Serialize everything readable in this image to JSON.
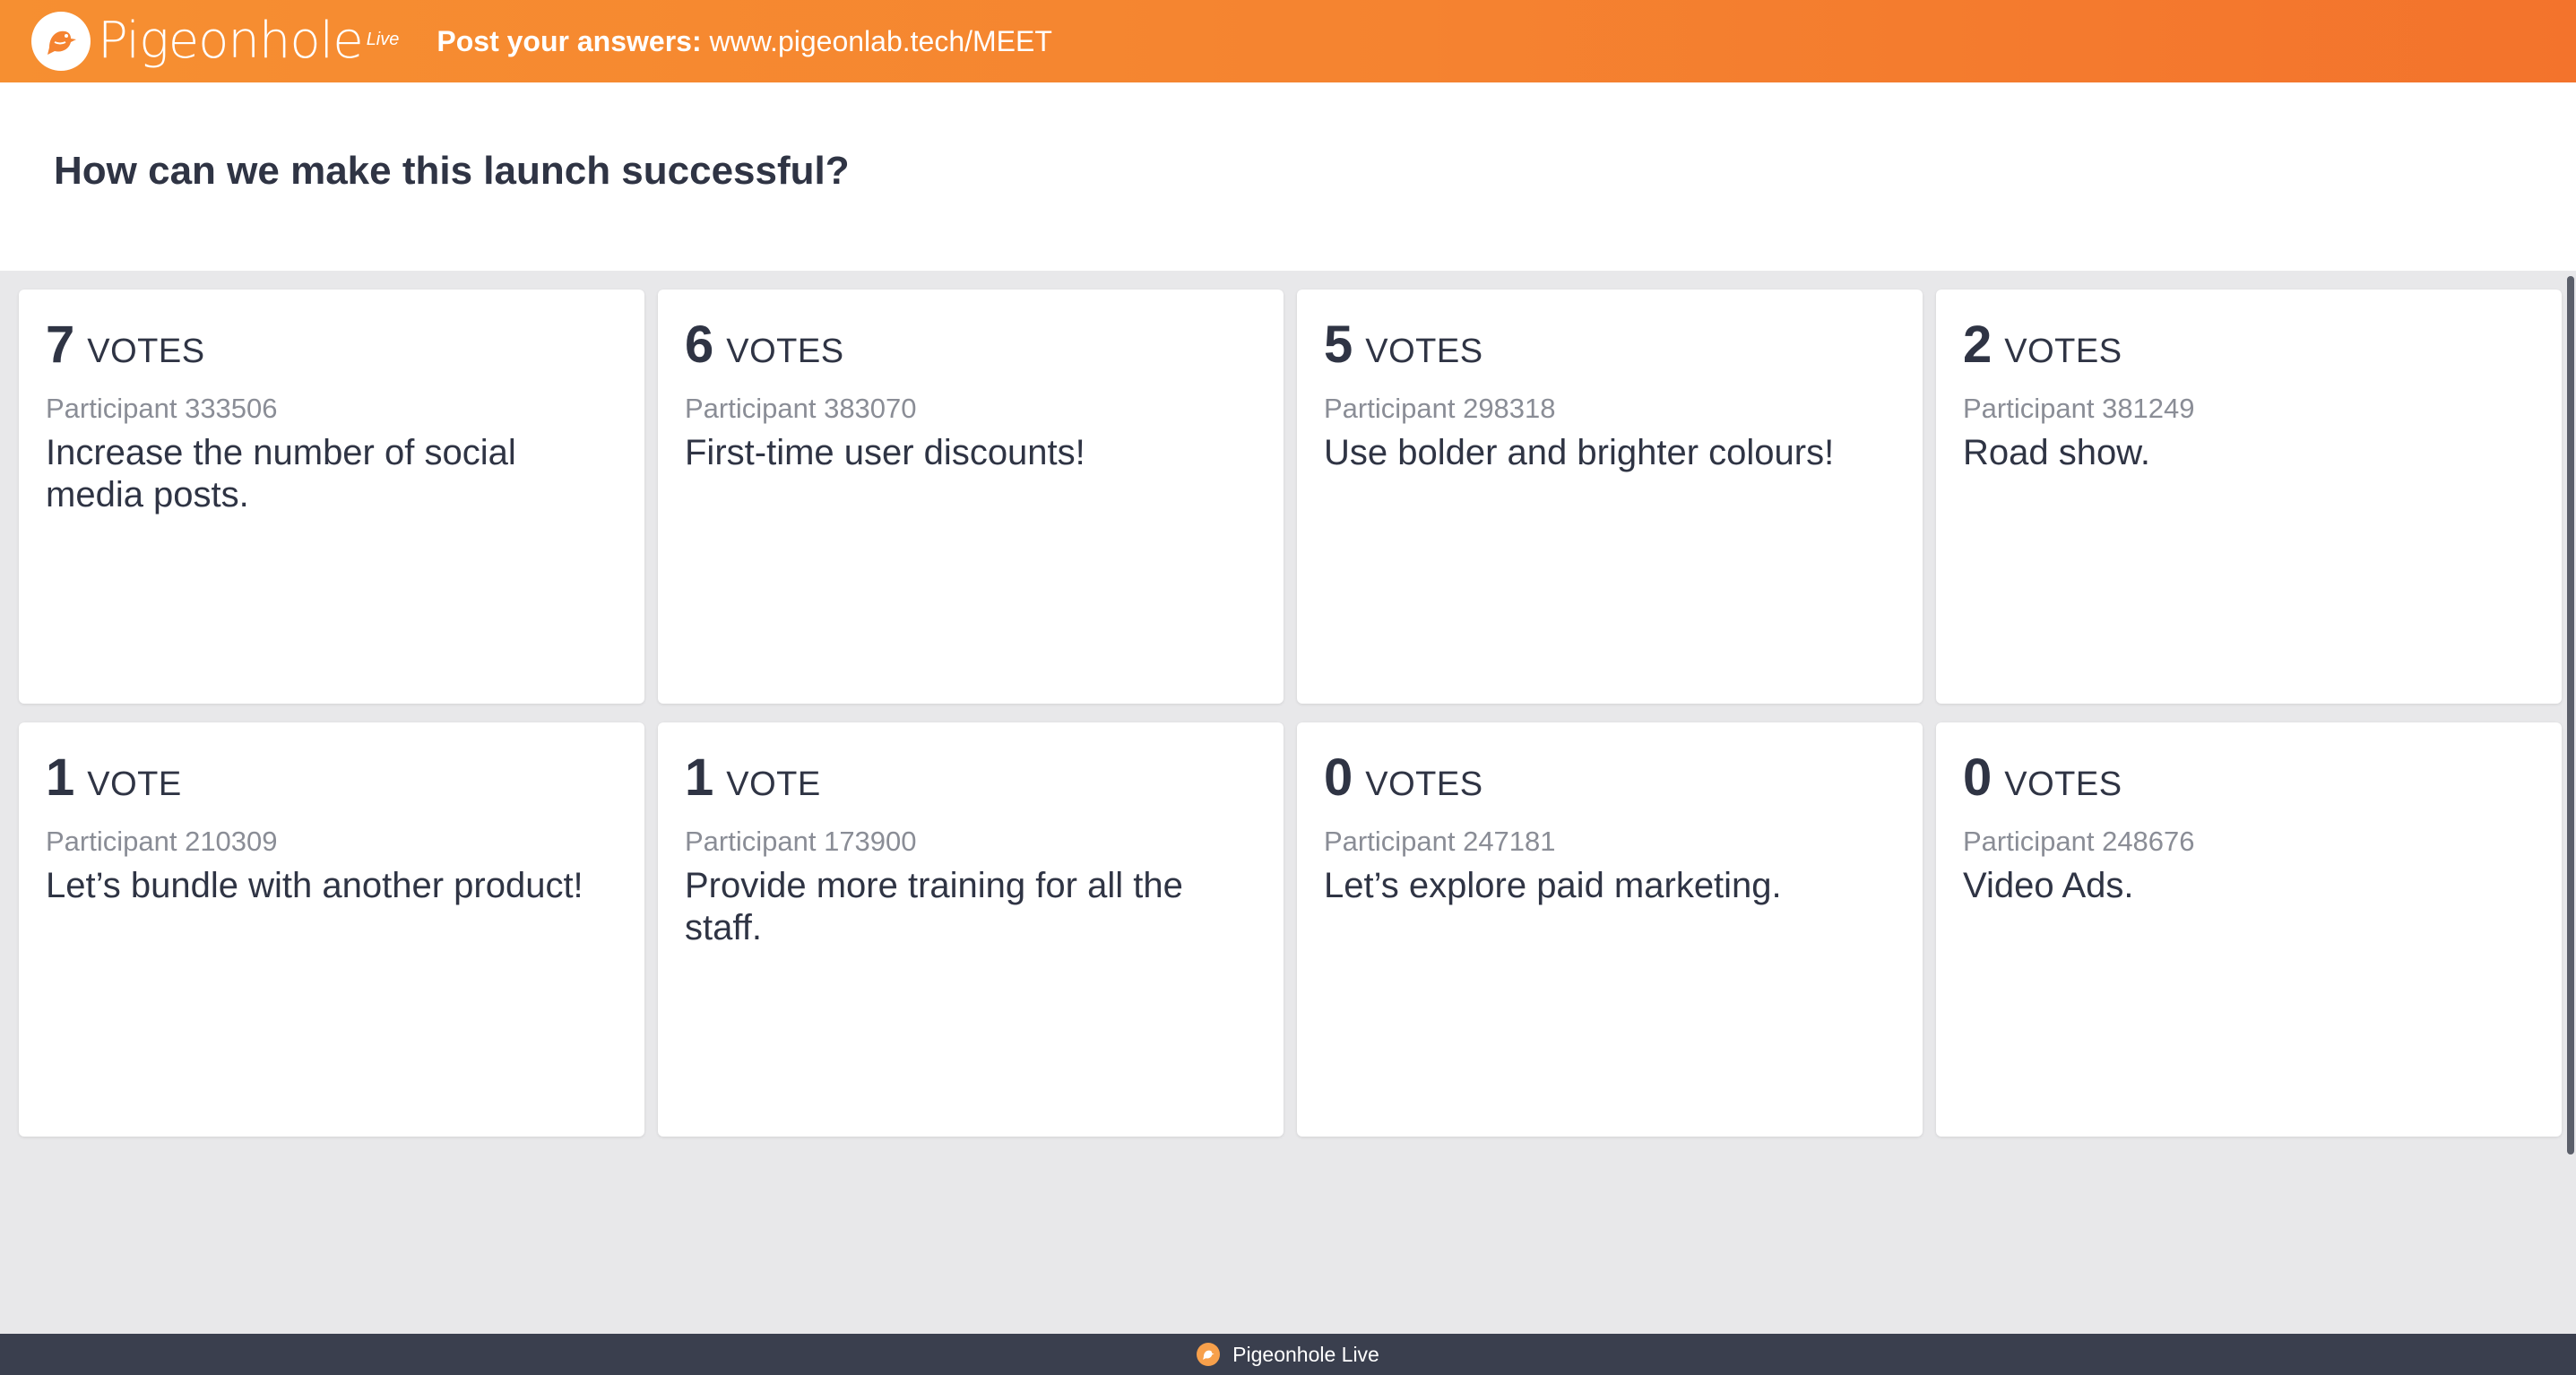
{
  "header": {
    "brand": "Pigeonhole",
    "brand_sup": "Live",
    "post_label": "Post your answers:",
    "post_url": "www.pigeonlab.tech/MEET"
  },
  "question": {
    "title": "How can we make this launch successful?"
  },
  "cards": [
    {
      "votes": "7",
      "unit": "VOTES",
      "participant": "Participant 333506",
      "answer": "Increase the number of social media posts."
    },
    {
      "votes": "6",
      "unit": "VOTES",
      "participant": "Participant 383070",
      "answer": "First-time user discounts!"
    },
    {
      "votes": "5",
      "unit": "VOTES",
      "participant": "Participant 298318",
      "answer": "Use bolder and brighter colours!"
    },
    {
      "votes": "2",
      "unit": "VOTES",
      "participant": "Participant 381249",
      "answer": "Road show."
    },
    {
      "votes": "1",
      "unit": "VOTE",
      "participant": "Participant 210309",
      "answer": "Let’s bundle with another product!"
    },
    {
      "votes": "1",
      "unit": "VOTE",
      "participant": "Participant 173900",
      "answer": "Provide more training for all the staff."
    },
    {
      "votes": "0",
      "unit": "VOTES",
      "participant": "Participant 247181",
      "answer": "Let’s explore paid marketing."
    },
    {
      "votes": "0",
      "unit": "VOTES",
      "participant": "Participant 248676",
      "answer": "Video Ads."
    }
  ],
  "footer": {
    "text": "Pigeonhole Live"
  },
  "colors": {
    "header_orange": "#f58330",
    "text_dark": "#2f3444",
    "text_muted": "#8a8d96",
    "footer_bg": "#3a3f4e"
  },
  "icons": {
    "logo": "pigeon-logo-icon"
  }
}
